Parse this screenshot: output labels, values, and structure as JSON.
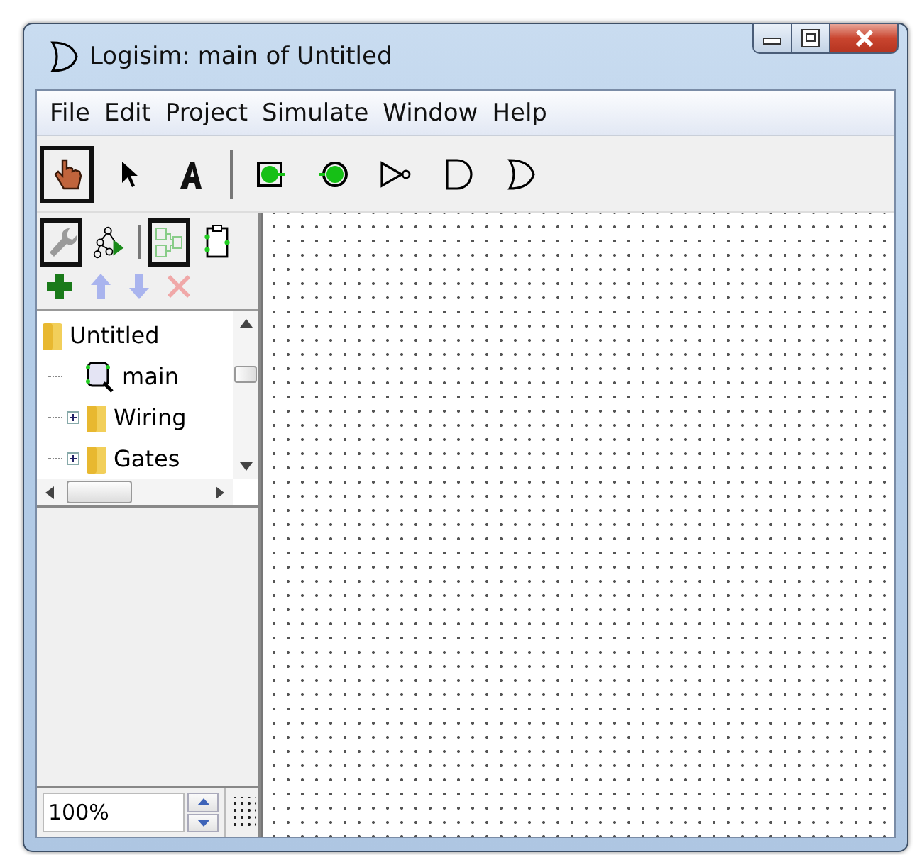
{
  "window": {
    "title": "Logisim: main of Untitled"
  },
  "menu": [
    "File",
    "Edit",
    "Project",
    "Simulate",
    "Window",
    "Help"
  ],
  "toolbar": [
    {
      "kind": "poke",
      "selected": true
    },
    {
      "kind": "select",
      "selected": false
    },
    {
      "kind": "text",
      "selected": false
    },
    {
      "kind": "separator"
    },
    {
      "kind": "input",
      "selected": false
    },
    {
      "kind": "output",
      "selected": false
    },
    {
      "kind": "not",
      "selected": false
    },
    {
      "kind": "and",
      "selected": false
    },
    {
      "kind": "or",
      "selected": false
    }
  ],
  "explorer_toolbar": [
    {
      "kind": "tools",
      "selected": true
    },
    {
      "kind": "simulation",
      "selected": false
    },
    {
      "kind": "separator"
    },
    {
      "kind": "layout",
      "selected": true
    },
    {
      "kind": "appearance",
      "selected": false
    }
  ],
  "explorer_actions": [
    {
      "kind": "add",
      "disabled": false
    },
    {
      "kind": "up",
      "disabled": true
    },
    {
      "kind": "down",
      "disabled": true
    },
    {
      "kind": "remove",
      "disabled": true
    }
  ],
  "tree": [
    {
      "label": "Untitled",
      "kind": "folder",
      "children": [
        {
          "label": "main",
          "kind": "circuit"
        },
        {
          "label": "Wiring",
          "kind": "folder",
          "expanded": false
        },
        {
          "label": "Gates",
          "kind": "folder",
          "expanded": false
        }
      ]
    }
  ],
  "zoom": {
    "value": "100%"
  }
}
